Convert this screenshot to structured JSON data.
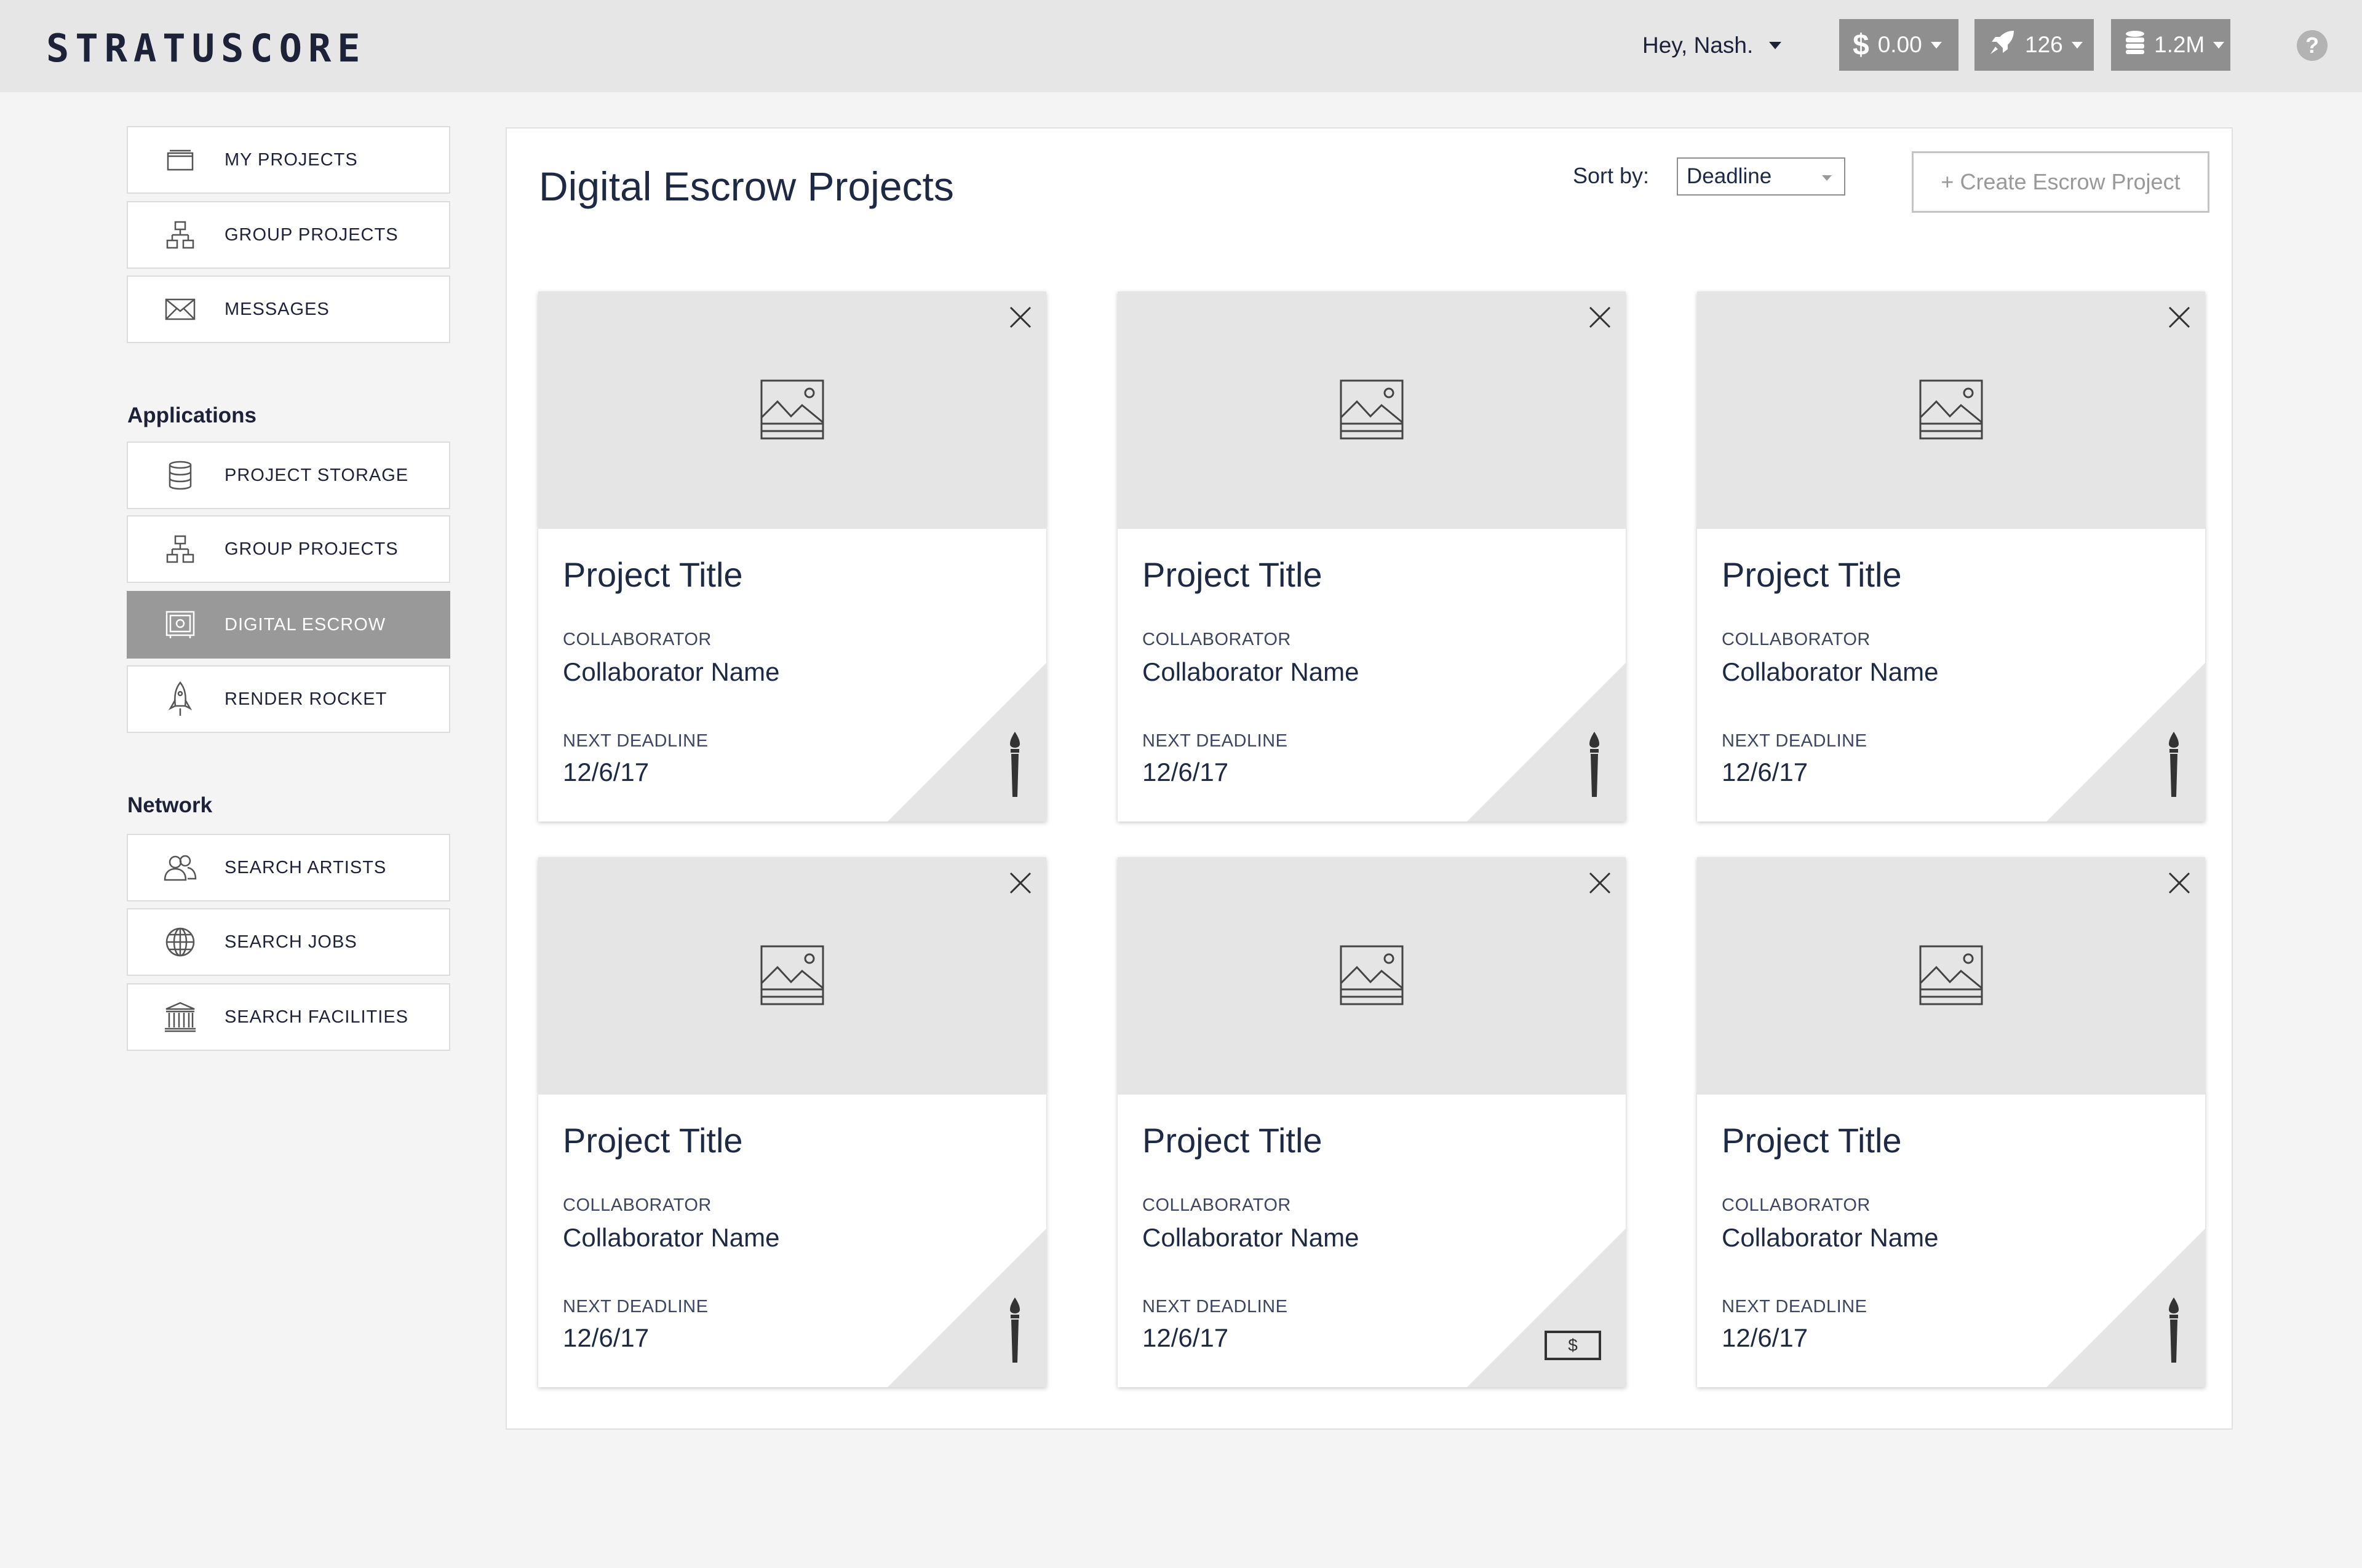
{
  "header": {
    "logo_text": "STRATUSCORE",
    "greeting": "Hey, Nash.",
    "balance": "0.00",
    "rockets": "126",
    "storage": "1.2M",
    "help": "?"
  },
  "sidebar": {
    "main_items": [
      {
        "label": "MY PROJECTS",
        "icon": "folder-icon"
      },
      {
        "label": "GROUP PROJECTS",
        "icon": "hierarchy-icon"
      },
      {
        "label": "MESSAGES",
        "icon": "envelope-icon"
      }
    ],
    "applications_heading": "Applications",
    "app_items": [
      {
        "label": "PROJECT STORAGE",
        "icon": "database-icon"
      },
      {
        "label": "GROUP PROJECTS",
        "icon": "hierarchy-icon"
      },
      {
        "label": "DIGITAL ESCROW",
        "icon": "safe-icon",
        "active": true
      },
      {
        "label": "RENDER ROCKET",
        "icon": "rocket-icon"
      }
    ],
    "network_heading": "Network",
    "network_items": [
      {
        "label": "SEARCH ARTISTS",
        "icon": "people-icon"
      },
      {
        "label": "SEARCH JOBS",
        "icon": "globe-icon"
      },
      {
        "label": "SEARCH FACILITIES",
        "icon": "building-icon"
      }
    ]
  },
  "main": {
    "title": "Digital Escrow Projects",
    "sort_label": "Sort by:",
    "sort_value": "Deadline",
    "create_label": "+ Create Escrow Project",
    "cards": [
      {
        "title": "Project Title",
        "collaborator_label": "COLLABORATOR",
        "collaborator": "Collaborator Name",
        "deadline_label": "NEXT DEADLINE",
        "deadline": "12/6/17",
        "status_icon": "paintbrush-icon"
      },
      {
        "title": "Project Title",
        "collaborator_label": "COLLABORATOR",
        "collaborator": "Collaborator Name",
        "deadline_label": "NEXT DEADLINE",
        "deadline": "12/6/17",
        "status_icon": "paintbrush-icon"
      },
      {
        "title": "Project Title",
        "collaborator_label": "COLLABORATOR",
        "collaborator": "Collaborator Name",
        "deadline_label": "NEXT DEADLINE",
        "deadline": "12/6/17",
        "status_icon": "paintbrush-icon"
      },
      {
        "title": "Project Title",
        "collaborator_label": "COLLABORATOR",
        "collaborator": "Collaborator Name",
        "deadline_label": "NEXT DEADLINE",
        "deadline": "12/6/17",
        "status_icon": "paintbrush-icon"
      },
      {
        "title": "Project Title",
        "collaborator_label": "COLLABORATOR",
        "collaborator": "Collaborator Name",
        "deadline_label": "NEXT DEADLINE",
        "deadline": "12/6/17",
        "status_icon": "money-bill-icon",
        "status_text": "$"
      },
      {
        "title": "Project Title",
        "collaborator_label": "COLLABORATOR",
        "collaborator": "Collaborator Name",
        "deadline_label": "NEXT DEADLINE",
        "deadline": "12/6/17",
        "status_icon": "paintbrush-icon"
      }
    ]
  },
  "colors": {
    "topbar": "#e6e6e6",
    "pill": "#8f8f8f",
    "active_nav": "#999999",
    "text_dark": "#1e2a44",
    "placeholder": "#e5e5e5"
  }
}
